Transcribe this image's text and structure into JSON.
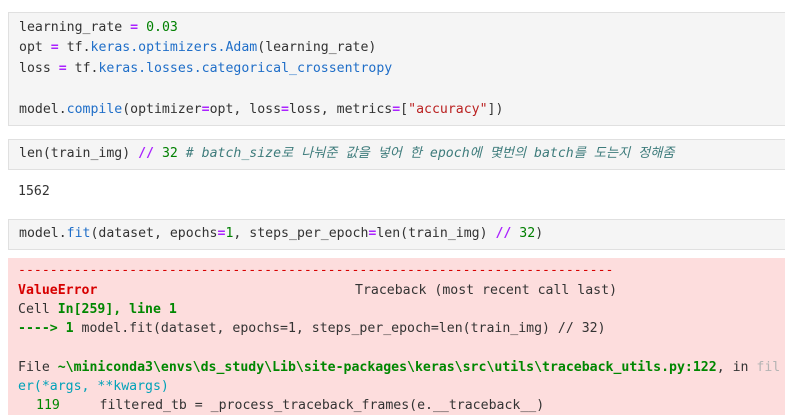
{
  "cell1": {
    "l1": {
      "a": "learning_rate",
      "eq": "=",
      "v": "0.03"
    },
    "l2": {
      "a": "opt",
      "eq": "=",
      "b": "tf.",
      "c": "keras.optimizers.Adam",
      "d": "(learning_rate)"
    },
    "l3": {
      "a": "loss",
      "eq": "=",
      "b": "tf.",
      "c": "keras.losses.categorical_crossentropy"
    },
    "l4": {
      "a": "model.",
      "b": "compile",
      "c": "(optimizer",
      "eq1": "=",
      "d": "opt, loss",
      "eq2": "=",
      "e": "loss, metrics",
      "eq3": "=",
      "f": "[",
      "g": "\"accuracy\"",
      "h": "])"
    }
  },
  "cell2": {
    "a": "len(train_img) ",
    "op": "//",
    "b": " ",
    "n": "32",
    "comment": " # batch_size로 나눠준 값을 넣어 한 epoch에 몇번의 batch를 도는지 정해줌"
  },
  "output2": "1562",
  "cell3": {
    "a": "model.",
    "b": "fit",
    "c": "(dataset, epochs",
    "eq1": "=",
    "n1": "1",
    "d": ", steps_per_epoch",
    "eq2": "=",
    "e": "len(train_img) ",
    "op": "//",
    "f": " ",
    "n2": "32",
    "g": ")"
  },
  "error": {
    "rule": "---------------------------------------------------------------------------",
    "type": "ValueError",
    "traceback_label": "Traceback (most recent call last)",
    "cell_prefix": "Cell ",
    "cell_ref": "In[259], line 1",
    "arrow": "----> 1 ",
    "arrow_code": "model.fit(dataset, epochs=1, steps_per_epoch=len(train_img) // 32)",
    "file_prefix": "File ",
    "file_path": "~\\miniconda3\\envs\\ds_study\\Lib\\site-packages\\keras\\src\\utils\\traceback_utils.py:122",
    "file_in": ", in ",
    "file_func_fade": "fil",
    "func_tail": "er(*args, **kwargs)",
    "line_no": "119",
    "line_code": "     filtered_tb = _process_traceback_frames(e.__traceback__)"
  }
}
